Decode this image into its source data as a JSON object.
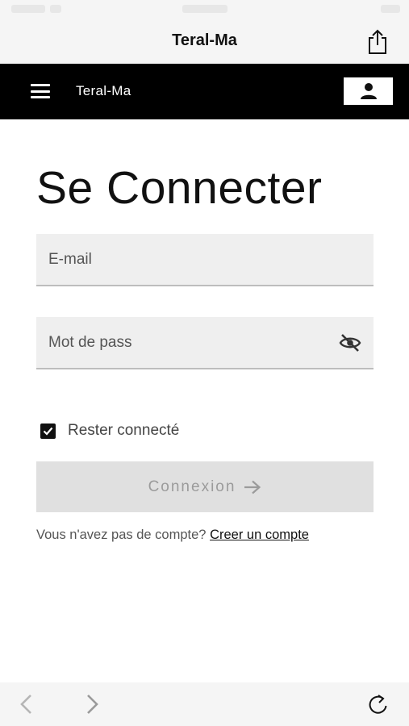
{
  "browser": {
    "page_title": "Teral-Ma"
  },
  "navbar": {
    "brand": "Teral-Ma",
    "bg_color": "#000000"
  },
  "login": {
    "heading": "Se Connecter",
    "email_placeholder": "E-mail",
    "password_placeholder": "Mot de pass",
    "remember_label": "Rester connecté",
    "remember_checked": true,
    "submit_label": "Connexion",
    "no_account_text": "Vous n'avez pas de compte?",
    "create_account_link": "Creer un compte"
  },
  "icons": {
    "share": "share-icon",
    "menu": "hamburger-menu-icon",
    "user": "user-icon",
    "password_visibility": "eye-slash-icon",
    "checkbox": "checkmark-icon",
    "submit_arrow": "arrow-right-icon",
    "back": "chevron-left-icon",
    "forward": "chevron-right-icon",
    "reload": "reload-icon"
  }
}
